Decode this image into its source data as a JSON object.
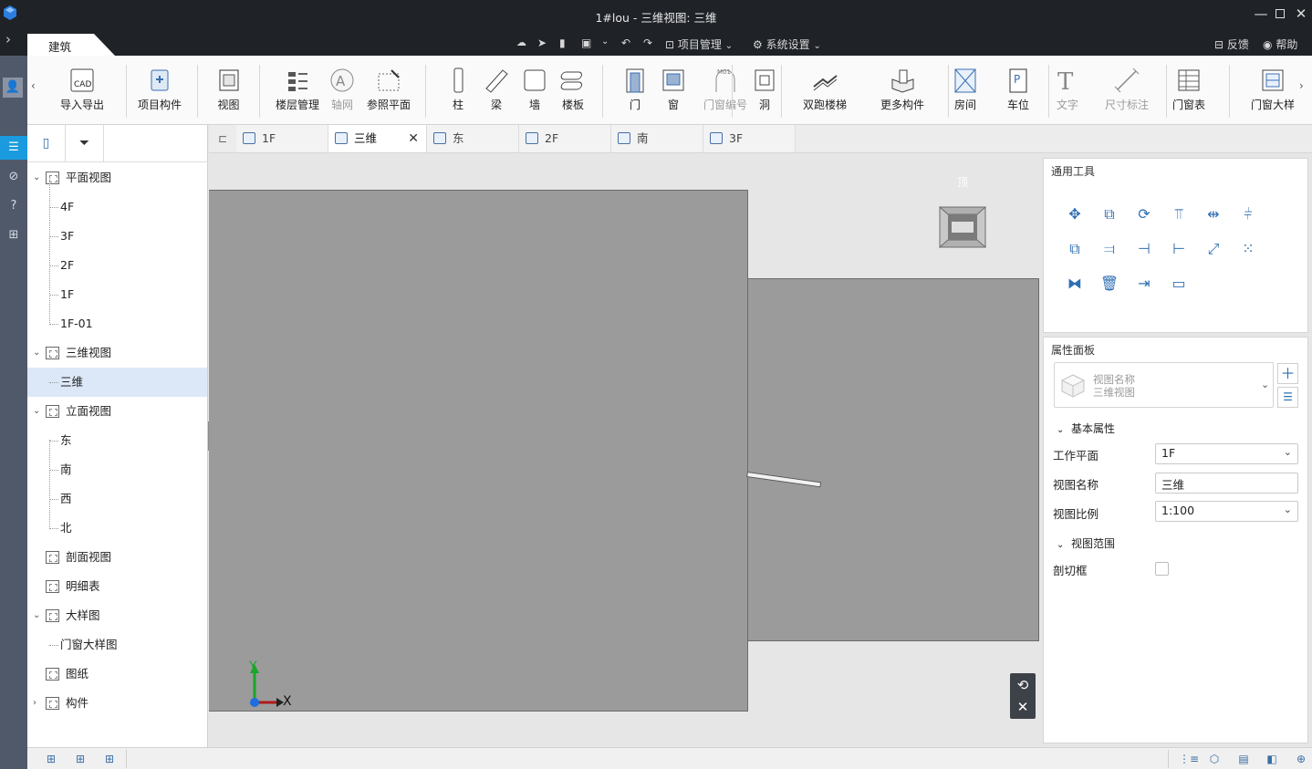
{
  "window": {
    "title": "1#lou - 三维视图: 三维",
    "minimize_icon": "minimize-icon",
    "maximize_icon": "maximize-icon",
    "close_icon": "close-icon"
  },
  "menubar": {
    "active_tab": "建筑",
    "project_menu": "项目管理",
    "settings_menu": "系统设置",
    "feedback": "反馈",
    "help": "帮助"
  },
  "ribbon": {
    "items": [
      {
        "label": "导入导出",
        "icon": "cad-import-export-icon",
        "enabled": true
      },
      {
        "label": "项目构件",
        "icon": "project-component-icon",
        "enabled": true
      },
      {
        "label": "视图",
        "icon": "view-icon",
        "enabled": true
      },
      {
        "label": "楼层管理",
        "icon": "floor-management-icon",
        "enabled": true
      },
      {
        "label": "轴网",
        "icon": "axis-grid-icon",
        "enabled": false
      },
      {
        "label": "参照平面",
        "icon": "reference-plane-icon",
        "enabled": true
      },
      {
        "label": "柱",
        "icon": "column-icon",
        "enabled": true
      },
      {
        "label": "梁",
        "icon": "beam-icon",
        "enabled": true
      },
      {
        "label": "墙",
        "icon": "wall-icon",
        "enabled": true
      },
      {
        "label": "楼板",
        "icon": "slab-icon",
        "enabled": true
      },
      {
        "label": "门",
        "icon": "door-icon",
        "enabled": true
      },
      {
        "label": "窗",
        "icon": "window-icon",
        "enabled": true
      },
      {
        "label": "门窗编号",
        "icon": "door-window-number-icon",
        "enabled": false,
        "badge": "M01"
      },
      {
        "label": "洞",
        "icon": "opening-icon",
        "enabled": true
      },
      {
        "label": "双跑楼梯",
        "icon": "double-run-stair-icon",
        "enabled": true
      },
      {
        "label": "更多构件",
        "icon": "more-components-icon",
        "enabled": true
      },
      {
        "label": "房间",
        "icon": "room-icon",
        "enabled": true
      },
      {
        "label": "车位",
        "icon": "parking-icon",
        "enabled": true
      },
      {
        "label": "文字",
        "icon": "text-icon",
        "enabled": false
      },
      {
        "label": "尺寸标注",
        "icon": "dimension-icon",
        "enabled": false
      },
      {
        "label": "门窗表",
        "icon": "door-window-table-icon",
        "enabled": true
      },
      {
        "label": "门窗大样",
        "icon": "door-window-detail-icon",
        "enabled": true
      }
    ]
  },
  "tree": {
    "nodes": [
      {
        "label": "平面视图",
        "level": 0,
        "expander": "v"
      },
      {
        "label": "4F",
        "level": 1
      },
      {
        "label": "3F",
        "level": 1
      },
      {
        "label": "2F",
        "level": 1
      },
      {
        "label": "1F",
        "level": 1
      },
      {
        "label": "1F-01",
        "level": 1
      },
      {
        "label": "三维视图",
        "level": 0,
        "expander": "v"
      },
      {
        "label": "三维",
        "level": 1,
        "selected": true
      },
      {
        "label": "立面视图",
        "level": 0,
        "expander": "v"
      },
      {
        "label": "东",
        "level": 1
      },
      {
        "label": "南",
        "level": 1
      },
      {
        "label": "西",
        "level": 1
      },
      {
        "label": "北",
        "level": 1
      },
      {
        "label": "剖面视图",
        "level": 0
      },
      {
        "label": "明细表",
        "level": 0
      },
      {
        "label": "大样图",
        "level": 0,
        "expander": "v"
      },
      {
        "label": "门窗大样图",
        "level": 1
      },
      {
        "label": "图纸",
        "level": 0
      },
      {
        "label": "构件",
        "level": 0,
        "expander": ">"
      }
    ]
  },
  "tabs": [
    {
      "label": "1F",
      "active": false
    },
    {
      "label": "三维",
      "active": true,
      "closable": true
    },
    {
      "label": "东",
      "active": false
    },
    {
      "label": "2F",
      "active": false
    },
    {
      "label": "南",
      "active": false
    },
    {
      "label": "3F",
      "active": false
    }
  ],
  "viewport": {
    "viewcube_label": "顶",
    "axis_x": "X",
    "axis_y": "Y"
  },
  "tools_panel": {
    "title": "通用工具",
    "tools": [
      "move-icon",
      "copy-icon",
      "rotate-icon",
      "align-top-icon",
      "align-center-icon",
      "split-icon",
      "array-icon",
      "align-right-icon",
      "trim-icon",
      "extend-icon",
      "offset-icon",
      "distribute-icon",
      "mirror-icon",
      "delete-icon",
      "stretch-icon",
      "measure-icon"
    ]
  },
  "properties": {
    "title": "属性面板",
    "type_name_label": "视图名称",
    "type_name_value": "三维视图",
    "section_basic": "基本属性",
    "section_range": "视图范围",
    "rows": [
      {
        "label": "工作平面",
        "value": "1F",
        "dropdown": true
      },
      {
        "label": "视图名称",
        "value": "三维",
        "dropdown": false
      },
      {
        "label": "视图比例",
        "value": "1:100",
        "dropdown": true
      }
    ],
    "section_box_label": "剖切框",
    "section_box_checked": false
  }
}
